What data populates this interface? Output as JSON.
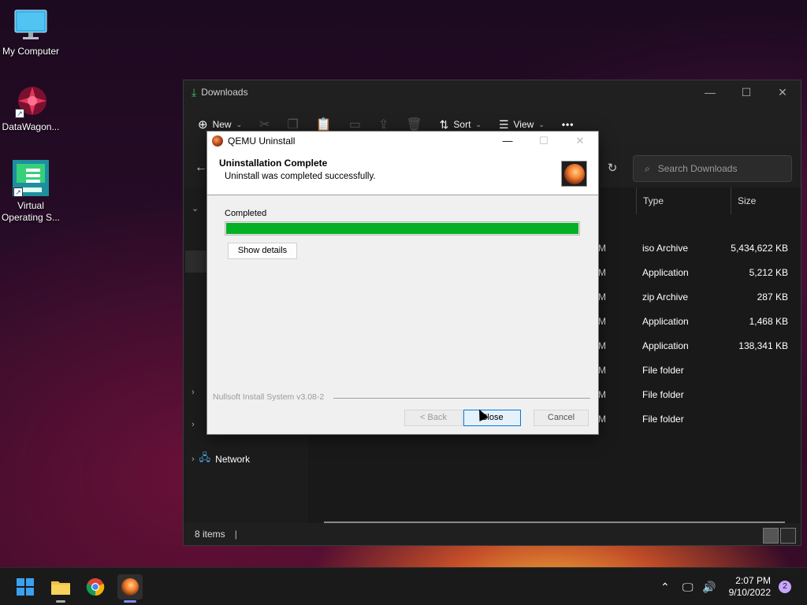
{
  "desktop": {
    "icons": [
      {
        "label": "My Computer"
      },
      {
        "label": "DataWagon..."
      },
      {
        "label": "Virtual Operating S..."
      }
    ]
  },
  "explorer": {
    "title": "Downloads",
    "toolbar": {
      "new_label": "New",
      "sort_label": "Sort",
      "view_label": "View",
      "more_label": "•••"
    },
    "search_placeholder": "Search Downloads",
    "columns": {
      "type": "Type",
      "size": "Size"
    },
    "rows": [
      {
        "date_frag": "M",
        "type": "iso Archive",
        "size": "5,434,622 KB"
      },
      {
        "date_frag": "M",
        "type": "Application",
        "size": "5,212 KB"
      },
      {
        "date_frag": "M",
        "type": "zip Archive",
        "size": "287 KB"
      },
      {
        "date_frag": "M",
        "type": "Application",
        "size": "1,468 KB"
      },
      {
        "date_frag": "M",
        "type": "Application",
        "size": "138,341 KB"
      },
      {
        "date_frag": "M",
        "type": "File folder",
        "size": ""
      },
      {
        "date_frag": "M",
        "type": "File folder",
        "size": ""
      },
      {
        "date_frag": "M",
        "type": "File folder",
        "size": ""
      }
    ],
    "nav_network": "Network",
    "status": "8 items"
  },
  "dialog": {
    "title": "QEMU Uninstall",
    "heading": "Uninstallation Complete",
    "subheading": "Uninstall was completed successfully.",
    "status_label": "Completed",
    "progress_percent": 100,
    "details_button": "Show details",
    "branding": "Nullsoft Install System v3.08-2",
    "back_button": "< Back",
    "close_button": "Close",
    "cancel_button": "Cancel"
  },
  "taskbar": {
    "time": "2:07 PM",
    "date": "9/10/2022",
    "notification_count": "2"
  },
  "colors": {
    "progress_fill": "#06b025",
    "accent_focus": "#0078d7",
    "explorer_bg": "#1f1f1f",
    "dialog_bg": "#f0f0f0"
  }
}
